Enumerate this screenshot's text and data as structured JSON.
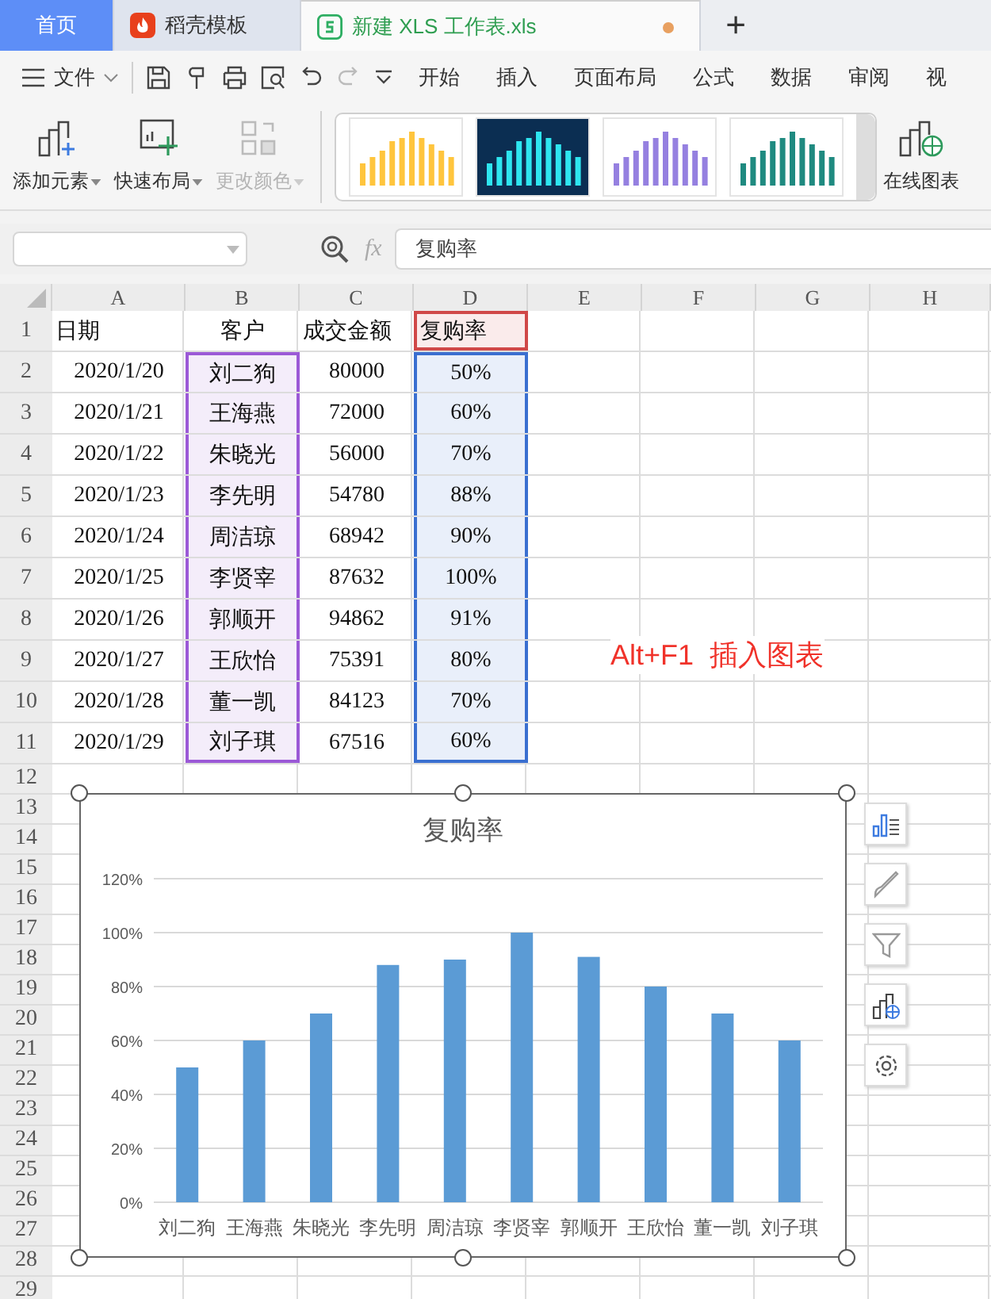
{
  "tabs": [
    {
      "kind": "home",
      "label": "首页",
      "selected": false
    },
    {
      "kind": "template",
      "label": "稻壳模板",
      "selected": false
    },
    {
      "kind": "sheet",
      "label": "新建 XLS 工作表.xls",
      "selected": true,
      "modified": true
    }
  ],
  "new_tab": "+",
  "menu": {
    "file": "文件",
    "items": [
      "开始",
      "插入",
      "页面布局",
      "公式",
      "数据",
      "审阅",
      "视"
    ]
  },
  "ribbon": {
    "buttons": [
      {
        "kind": "add",
        "label": "添加元素",
        "disabled": false,
        "dropdown": true
      },
      {
        "kind": "layout",
        "label": "快速布局",
        "disabled": false,
        "dropdown": true
      },
      {
        "kind": "recolor",
        "label": "更改颜色",
        "disabled": true,
        "dropdown": true
      }
    ],
    "styles": [
      {
        "color": "#ffc53d",
        "dark": false
      },
      {
        "color": "#2ee6f0",
        "dark": true
      },
      {
        "color": "#9580e0",
        "dark": false
      },
      {
        "color": "#1f8a80",
        "dark": false
      }
    ],
    "online": "在线图表"
  },
  "formula_bar": {
    "fx": "fx",
    "value": "复购率"
  },
  "sheet": {
    "columns": [
      {
        "letter": "A"
      },
      {
        "letter": "B",
        "color": "#9b59d6"
      },
      {
        "letter": "C"
      },
      {
        "letter": "D",
        "color": "#3a6fd0"
      },
      {
        "letter": "E"
      },
      {
        "letter": "F"
      },
      {
        "letter": "G"
      },
      {
        "letter": "H"
      }
    ],
    "header": {
      "number": "1",
      "cells": [
        {
          "text": "日期"
        },
        {
          "text": "客户"
        },
        {
          "text": "成交金额"
        },
        {
          "text": "复购率",
          "color": "#d04848"
        }
      ]
    },
    "rows": [
      {
        "number": "2",
        "cells": [
          "2020/1/20",
          "刘二狗",
          "80000",
          "50%"
        ]
      },
      {
        "number": "3",
        "cells": [
          "2020/1/21",
          "王海燕",
          "72000",
          "60%"
        ]
      },
      {
        "number": "4",
        "cells": [
          "2020/1/22",
          "朱晓光",
          "56000",
          "70%"
        ]
      },
      {
        "number": "5",
        "cells": [
          "2020/1/23",
          "李先明",
          "54780",
          "88%"
        ]
      },
      {
        "number": "6",
        "cells": [
          "2020/1/24",
          "周洁琼",
          "68942",
          "90%"
        ]
      },
      {
        "number": "7",
        "cells": [
          "2020/1/25",
          "李贤宰",
          "87632",
          "100%"
        ]
      },
      {
        "number": "8",
        "cells": [
          "2020/1/26",
          "郭顺开",
          "94862",
          "91%"
        ]
      },
      {
        "number": "9",
        "cells": [
          "2020/1/27",
          "王欣怡",
          "75391",
          "80%"
        ]
      },
      {
        "number": "10",
        "cells": [
          "2020/1/28",
          "董一凯",
          "84123",
          "70%"
        ]
      },
      {
        "number": "11",
        "cells": [
          "2020/1/29",
          "刘子琪",
          "67516",
          "60%"
        ]
      }
    ],
    "empty_rows": [
      "12",
      "13",
      "14",
      "15",
      "16",
      "17",
      "18",
      "19",
      "20",
      "21",
      "22",
      "23",
      "24",
      "25",
      "26",
      "27",
      "28",
      "29"
    ],
    "note": "Alt+F1  插入图表",
    "chart": {
      "chart_data": {
        "type": "bar",
        "title": "复购率",
        "categories": [
          "刘二狗",
          "王海燕",
          "朱晓光",
          "李先明",
          "周洁琼",
          "李贤宰",
          "郭顺开",
          "王欣怡",
          "董一凯",
          "刘子琪"
        ],
        "series": [
          {
            "color": "#5b9bd5",
            "values": [
              50,
              60,
              70,
              88,
              90,
              100,
              91,
              80,
              70,
              60
            ]
          }
        ],
        "grid": true,
        "ylim": [
          0,
          120
        ],
        "yticks": [
          {
            "value": 0,
            "label": "0%"
          },
          {
            "value": 20,
            "label": "20%"
          },
          {
            "value": 40,
            "label": "40%"
          },
          {
            "value": 60,
            "label": "60%"
          },
          {
            "value": 80,
            "label": "80%"
          },
          {
            "value": 100,
            "label": "100%"
          },
          {
            "value": 120,
            "label": "120%"
          }
        ]
      },
      "tools": [
        {
          "kind": "elements"
        },
        {
          "kind": "style"
        },
        {
          "kind": "filter"
        },
        {
          "kind": "online"
        },
        {
          "kind": "settings"
        }
      ]
    }
  }
}
